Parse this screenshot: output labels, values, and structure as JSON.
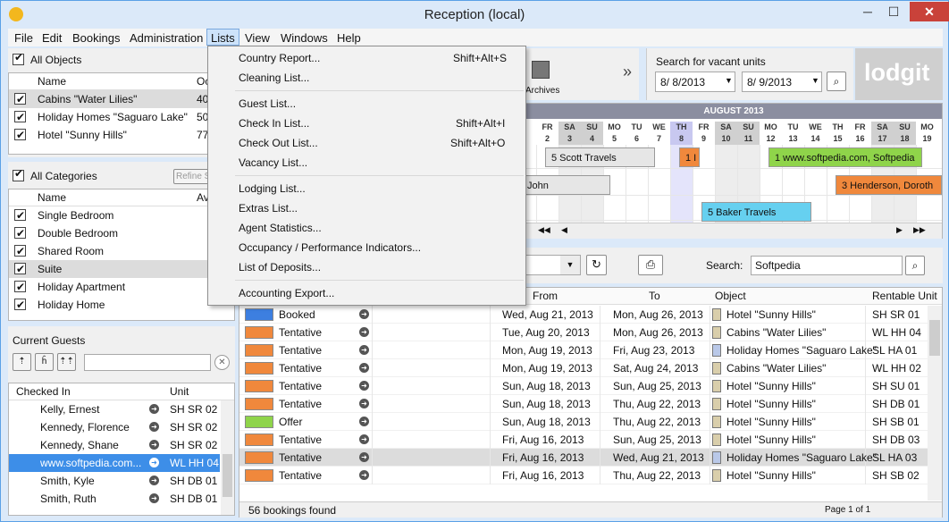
{
  "window": {
    "title": "Reception (local)",
    "min": "─",
    "max": "☐",
    "close": "✕"
  },
  "menu": [
    "File",
    "Edit",
    "Bookings",
    "Administration",
    "Lists",
    "View",
    "Windows",
    "Help"
  ],
  "lists_menu": {
    "items": [
      {
        "label": "Country Report...",
        "shortcut": "Shift+Alt+S"
      },
      {
        "label": "Cleaning List...",
        "shortcut": ""
      },
      {
        "label": "Guest List...",
        "shortcut": ""
      },
      {
        "label": "Check In List...",
        "shortcut": "Shift+Alt+I"
      },
      {
        "label": "Check Out List...",
        "shortcut": "Shift+Alt+O"
      },
      {
        "label": "Vacancy List...",
        "shortcut": ""
      },
      {
        "label": "Lodging List...",
        "shortcut": ""
      },
      {
        "label": "Extras List...",
        "shortcut": ""
      },
      {
        "label": "Agent Statistics...",
        "shortcut": ""
      },
      {
        "label": "Occupancy / Performance Indicators...",
        "shortcut": ""
      },
      {
        "label": "List of Deposits...",
        "shortcut": ""
      },
      {
        "label": "Accounting Export...",
        "shortcut": ""
      }
    ]
  },
  "objects": {
    "all_label": "All Objects",
    "columns": [
      "Name",
      "Oc"
    ],
    "rows": [
      {
        "name": "Cabins \"Water Lilies\"",
        "value": "40"
      },
      {
        "name": "Holiday Homes \"Saguaro Lake\"",
        "value": "50"
      },
      {
        "name": "Hotel \"Sunny Hills\"",
        "value": "77"
      }
    ]
  },
  "categories": {
    "all_label": "All Categories",
    "refine_label": "Refine S",
    "columns": [
      "Name",
      "Av"
    ],
    "rows": [
      "Single Bedroom",
      "Double Bedroom",
      "Shared Room",
      "Suite",
      "Holiday Apartment",
      "Holiday Home"
    ]
  },
  "guests": {
    "title": "Current Guests",
    "columns": [
      "Checked In",
      "Unit"
    ],
    "rows": [
      {
        "name": "Kelly, Ernest",
        "unit": "SH SR 02"
      },
      {
        "name": "Kennedy, Florence",
        "unit": "SH SR 02"
      },
      {
        "name": "Kennedy, Shane",
        "unit": "SH SR 02"
      },
      {
        "name": "www.softpedia.com...",
        "unit": "WL HH 04"
      },
      {
        "name": "Smith, Kyle",
        "unit": "SH DB 01"
      },
      {
        "name": "Smith, Ruth",
        "unit": "SH DB 01"
      }
    ]
  },
  "toolbar": {
    "archives_label": "Archives",
    "more": "»"
  },
  "vacancy": {
    "title": "Search for vacant units",
    "from": "8/  8/2013",
    "to": "8/  9/2013"
  },
  "logo": "lodgit",
  "calendar": {
    "month": "AUGUST 2013",
    "days": [
      {
        "d": "FR",
        "n": "2"
      },
      {
        "d": "SA",
        "n": "3"
      },
      {
        "d": "SU",
        "n": "4"
      },
      {
        "d": "MO",
        "n": "5"
      },
      {
        "d": "TU",
        "n": "6"
      },
      {
        "d": "WE",
        "n": "7"
      },
      {
        "d": "TH",
        "n": "8"
      },
      {
        "d": "FR",
        "n": "9"
      },
      {
        "d": "SA",
        "n": "10"
      },
      {
        "d": "SU",
        "n": "11"
      },
      {
        "d": "MO",
        "n": "12"
      },
      {
        "d": "TU",
        "n": "13"
      },
      {
        "d": "WE",
        "n": "14"
      },
      {
        "d": "TH",
        "n": "15"
      },
      {
        "d": "FR",
        "n": "16"
      },
      {
        "d": "SA",
        "n": "17"
      },
      {
        "d": "SU",
        "n": "18"
      },
      {
        "d": "MO",
        "n": "19"
      }
    ],
    "bars": [
      "5 Scott Travels",
      "1 I",
      "1 www.softpedia.com, Softpedia",
      "John",
      "3 Henderson, Doroth",
      "5 Baker Travels"
    ]
  },
  "search": {
    "label": "Search:",
    "value": "Softpedia"
  },
  "bookings": {
    "columns": [
      "From",
      "To",
      "Object",
      "Rentable Unit"
    ],
    "rows": [
      {
        "status": "Booked",
        "color": "#3d7fe0",
        "from": "Wed, Aug 21, 2013",
        "to": "Mon, Aug 26, 2013",
        "object": "Hotel \"Sunny Hills\"",
        "oc": "#d9ceab",
        "unit": "SH SR 01"
      },
      {
        "status": "Tentative",
        "color": "#f0883c",
        "from": "Tue, Aug 20, 2013",
        "to": "Mon, Aug 26, 2013",
        "object": "Cabins \"Water Lilies\"",
        "oc": "#d9ceab",
        "unit": "WL HH 04"
      },
      {
        "status": "Tentative",
        "color": "#f0883c",
        "from": "Mon, Aug 19, 2013",
        "to": "Fri, Aug 23, 2013",
        "object": "Holiday Homes \"Saguaro Lake\"",
        "oc": "#b9c8e8",
        "unit": "SL HA 01"
      },
      {
        "status": "Tentative",
        "color": "#f0883c",
        "from": "Mon, Aug 19, 2013",
        "to": "Sat, Aug 24, 2013",
        "object": "Cabins \"Water Lilies\"",
        "oc": "#d9ceab",
        "unit": "WL HH 02"
      },
      {
        "status": "Tentative",
        "color": "#f0883c",
        "from": "Sun, Aug 18, 2013",
        "to": "Sun, Aug 25, 2013",
        "object": "Hotel \"Sunny Hills\"",
        "oc": "#d9ceab",
        "unit": "SH SU 01"
      },
      {
        "status": "Tentative",
        "color": "#f0883c",
        "from": "Sun, Aug 18, 2013",
        "to": "Thu, Aug 22, 2013",
        "object": "Hotel \"Sunny Hills\"",
        "oc": "#d9ceab",
        "unit": "SH DB 01"
      },
      {
        "status": "Offer",
        "color": "#8fd44a",
        "from": "Sun, Aug 18, 2013",
        "to": "Thu, Aug 22, 2013",
        "object": "Hotel \"Sunny Hills\"",
        "oc": "#d9ceab",
        "unit": "SH SB 01"
      },
      {
        "status": "Tentative",
        "color": "#f0883c",
        "from": "Fri, Aug 16, 2013",
        "to": "Sun, Aug 25, 2013",
        "object": "Hotel \"Sunny Hills\"",
        "oc": "#d9ceab",
        "unit": "SH DB 03"
      },
      {
        "status": "Tentative",
        "color": "#f0883c",
        "from": "Fri, Aug 16, 2013",
        "to": "Wed, Aug 21, 2013",
        "object": "Holiday Homes \"Saguaro Lake\"",
        "oc": "#b9c8e8",
        "unit": "SL HA 03"
      },
      {
        "status": "Tentative",
        "color": "#f0883c",
        "from": "Fri, Aug 16, 2013",
        "to": "Thu, Aug 22, 2013",
        "object": "Hotel \"Sunny Hills\"",
        "oc": "#d9ceab",
        "unit": "SH SB 02"
      }
    ]
  },
  "status": {
    "count": "56 bookings found",
    "page": "Page 1 of 1"
  }
}
